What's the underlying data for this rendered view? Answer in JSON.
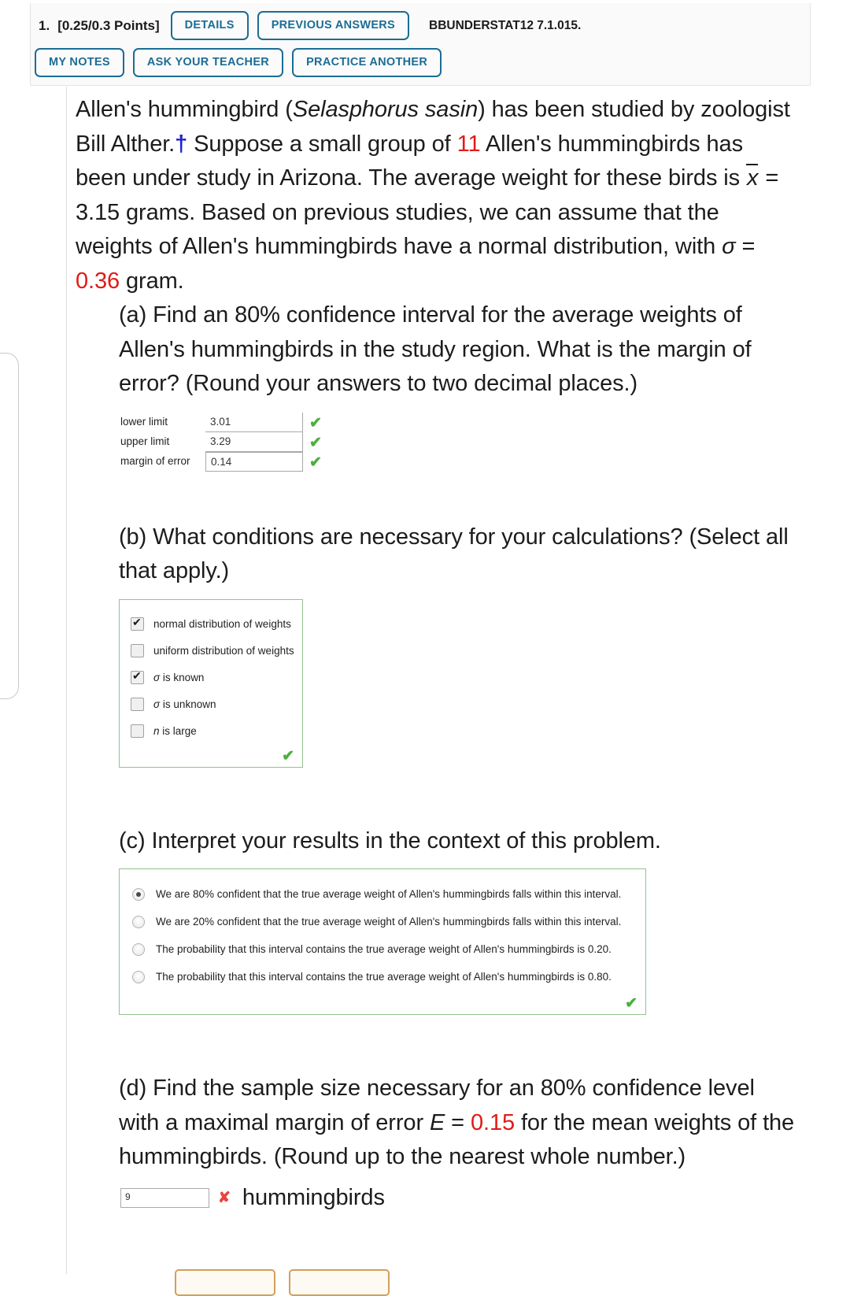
{
  "header": {
    "question_number": "1.",
    "points": "[0.25/0.3 Points]",
    "buttons_row1": [
      {
        "label": "DETAILS",
        "name": "details-button"
      },
      {
        "label": "PREVIOUS ANSWERS",
        "name": "previous-answers-button"
      }
    ],
    "source_code": "BBUNDERSTAT12 7.1.015.",
    "buttons_row2": [
      {
        "label": "MY NOTES",
        "name": "my-notes-button"
      },
      {
        "label": "ASK YOUR TEACHER",
        "name": "ask-your-teacher-button"
      },
      {
        "label": "PRACTICE ANOTHER",
        "name": "practice-another-button"
      }
    ]
  },
  "stem": {
    "s1": "Allen's hummingbird (",
    "species": "Selasphorus sasin",
    "s2": ") has been studied by zoologist Bill Alther.",
    "dagger": "†",
    "s3": " Suppose a small group of ",
    "n": "11",
    "s4": " Allen's hummingbirds has been under study in Arizona. The average weight for these birds is ",
    "xbar": "x",
    "s5": " = 3.15 grams. Based on previous studies, we can assume that the weights of Allen's hummingbirds have a normal distribution, with ",
    "sigma": "σ",
    "s6": " = ",
    "sigma_value": "0.36",
    "s7": " gram."
  },
  "part_a": {
    "prompt": "(a) Find an 80% confidence interval for the average weights of Allen's hummingbirds in the study region. What is the margin of error? (Round your answers to two decimal places.)",
    "fields": [
      {
        "label": "lower limit",
        "value": "3.01",
        "status": "correct"
      },
      {
        "label": "upper limit",
        "value": "3.29",
        "status": "correct"
      },
      {
        "label": "margin of error",
        "value": "0.14",
        "status": "correct"
      }
    ],
    "correct_mark": "✔"
  },
  "part_b": {
    "prompt": "(b) What conditions are necessary for your calculations? (Select all that apply.)",
    "options": [
      {
        "label": "normal distribution of weights",
        "checked": true,
        "italic_prefix": ""
      },
      {
        "label": "uniform distribution of weights",
        "checked": false,
        "italic_prefix": ""
      },
      {
        "label": "is known",
        "checked": true,
        "italic_prefix": "σ"
      },
      {
        "label": "is unknown",
        "checked": false,
        "italic_prefix": "σ"
      },
      {
        "label": "is large",
        "checked": false,
        "italic_prefix": "n"
      }
    ],
    "group_mark": "✔"
  },
  "part_c": {
    "prompt": "(c) Interpret your results in the context of this problem.",
    "options": [
      {
        "label": "We are 80% confident that the true average weight of Allen's hummingbirds falls within this interval.",
        "selected": true
      },
      {
        "label": "We are 20% confident that the true average weight of Allen's hummingbirds falls within this interval.",
        "selected": false
      },
      {
        "label": "The probability that this interval contains the true average weight of Allen's hummingbirds is 0.20.",
        "selected": false
      },
      {
        "label": "The probability that this interval contains the true average weight of Allen's hummingbirds is 0.80.",
        "selected": false
      }
    ],
    "group_mark": "✔"
  },
  "part_d": {
    "p1": "(d) Find the sample size necessary for an 80% confidence level with a maximal margin of error ",
    "E": "E",
    "p2": " = ",
    "E_value": "0.15",
    "p3": " for the mean weights of the hummingbirds. (Round up to the nearest whole number.)",
    "answer_value": "9",
    "incorrect_mark": "✘",
    "unit_label": "hummingbirds"
  },
  "colors": {
    "accent_blue": "#1b6d94",
    "red": "#e01b17",
    "green": "#4caf3f",
    "green_border": "#94c28d",
    "incorrect_red": "#e8453c",
    "tan_button": "#d1a05a"
  }
}
